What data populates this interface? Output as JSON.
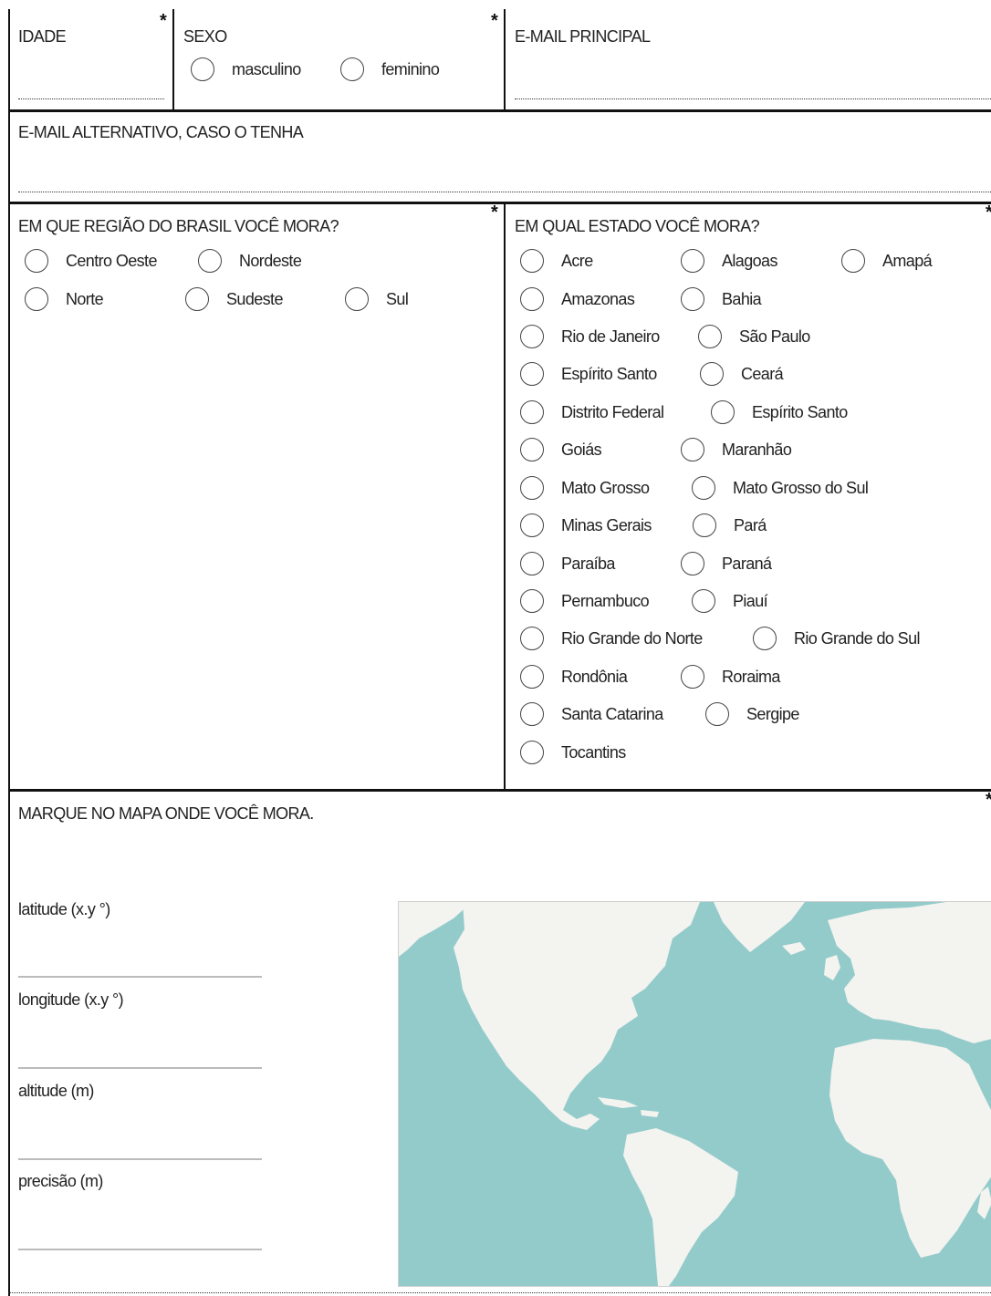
{
  "fields": {
    "idade": "IDADE",
    "sexo": "SEXO",
    "sexo_options": [
      "masculino",
      "feminino"
    ],
    "email_principal": "E-MAIL PRINCIPAL",
    "email_alternativo": "E-MAIL ALTERNATIVO, CASO O TENHA"
  },
  "regiao": {
    "question": "EM QUE REGIÃO DO BRASIL VOCÊ MORA?",
    "options": [
      "Centro Oeste",
      "Nordeste",
      "Norte",
      "Sudeste",
      "Sul"
    ]
  },
  "estado": {
    "question": "EM QUAL ESTADO VOCÊ MORA?",
    "options": [
      "Acre",
      "Alagoas",
      "Amapá",
      "Amazonas",
      "Bahia",
      "Rio de Janeiro",
      "São Paulo",
      "Espírito Santo",
      "Ceará",
      "Distrito Federal",
      "Espírito Santo",
      "Goiás",
      "Maranhão",
      "Mato Grosso",
      "Mato Grosso do Sul",
      "Minas Gerais",
      "Pará",
      "Paraíba",
      "Paraná",
      "Pernambuco",
      "Piauí",
      "Rio Grande do Norte",
      "Rio Grande do Sul",
      "Rondônia",
      "Roraima",
      "Santa Catarina",
      "Sergipe",
      "Tocantins"
    ]
  },
  "mapa": {
    "question": "MARQUE NO MAPA ONDE VOCÊ MORA.",
    "latitude": "latitude (x.y °)",
    "longitude": "longitude (x.y °)",
    "altitude": "altitude (m)",
    "precisao": "precisão (m)",
    "ocean_color": "#93cbcb",
    "land_color": "#f3f3ef"
  },
  "required_mark": "*"
}
